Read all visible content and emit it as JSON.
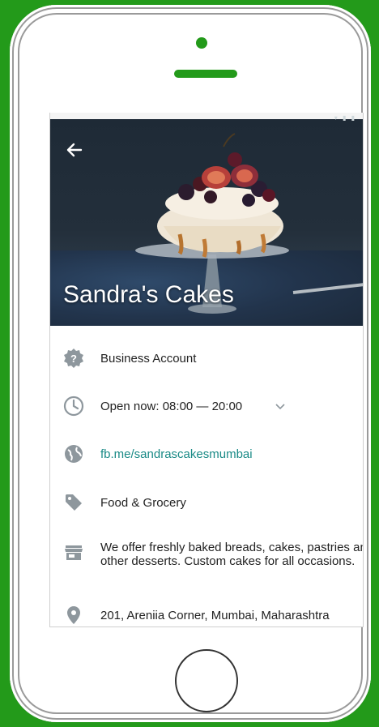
{
  "business": {
    "name": "Sandra's Cakes",
    "account_type": "Business Account",
    "hours": "Open now: 08:00 — 20:00",
    "website": "fb.me/sandrascakesmumbai",
    "category": "Food & Grocery",
    "description": "We offer freshly baked breads, cakes, pastries and other desserts. Custom cakes for all occasions.",
    "address": "201, Areniia Corner, Mumbai, Maharashtra"
  },
  "icons": {
    "back": "back-arrow-icon",
    "account": "question-badge-icon",
    "hours": "clock-icon",
    "expand": "chevron-down-icon",
    "website": "globe-icon",
    "category": "tag-icon",
    "description": "store-icon",
    "address": "location-pin-icon"
  },
  "colors": {
    "frame_background": "#239a1a",
    "link": "#1a8a86",
    "icon": "#8e979d"
  }
}
